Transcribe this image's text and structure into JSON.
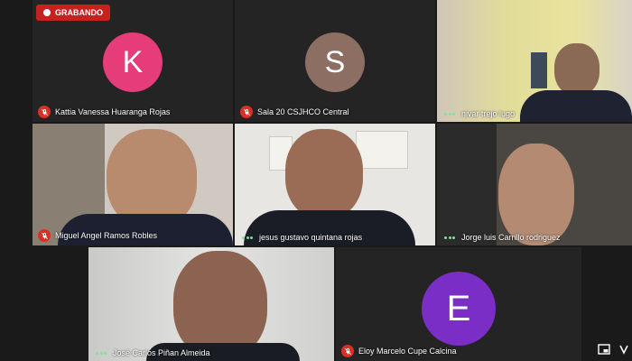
{
  "recording": {
    "label": "GRABANDO",
    "color": "#c5221f"
  },
  "participants": [
    {
      "name": "Kattia Vanessa Huaranga Rojas",
      "initial": "K",
      "avatar_color": "#e63d7a",
      "muted": true
    },
    {
      "name": "Sala 20 CSJHCO Central",
      "initial": "S",
      "avatar_color": "#8d6e63",
      "muted": true
    },
    {
      "name": "nivar trejo lugo",
      "muted": false
    },
    {
      "name": "Miguel Angel Ramos Robles",
      "muted": true
    },
    {
      "name": "jesus gustavo quintana rojas",
      "muted": false
    },
    {
      "name": "Jorge luis Carrillo rodriguez",
      "muted": false
    },
    {
      "name": "José Carlos Piñan Almeida",
      "muted": false
    },
    {
      "name": "Eloy Marcelo Cupe Calcina",
      "initial": "E",
      "avatar_color": "#7b2ec6",
      "muted": true
    }
  ],
  "icons": {
    "mute": "mic-off-icon",
    "speaking": "audio-dots-icon",
    "corner_left": "picture-in-picture-icon",
    "corner_right": "more-options-icon"
  }
}
